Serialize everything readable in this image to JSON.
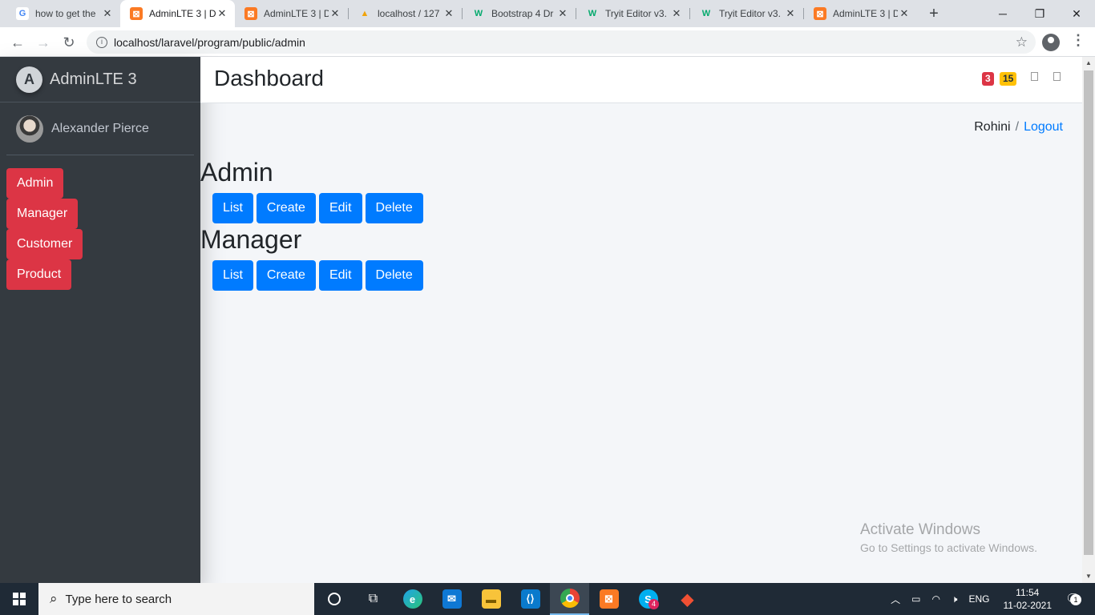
{
  "browser": {
    "tabs": [
      {
        "title": "how to get the",
        "favicon": "google-icon"
      },
      {
        "title": "AdminLTE 3 | D",
        "favicon": "xampp-icon",
        "active": true
      },
      {
        "title": "AdminLTE 3 | D",
        "favicon": "xampp-icon"
      },
      {
        "title": "localhost / 127",
        "favicon": "phpmyadmin-icon"
      },
      {
        "title": "Bootstrap 4 Dr",
        "favicon": "w3schools-icon"
      },
      {
        "title": "Tryit Editor v3.",
        "favicon": "w3schools-icon"
      },
      {
        "title": "Tryit Editor v3.",
        "favicon": "w3schools-icon"
      },
      {
        "title": "AdminLTE 3 | D",
        "favicon": "xampp-icon"
      }
    ],
    "url": "localhost/laravel/program/public/admin"
  },
  "sidebar": {
    "brand": "AdminLTE 3",
    "user": "Alexander Pierce",
    "items": [
      {
        "label": "Admin"
      },
      {
        "label": "Manager"
      },
      {
        "label": "Customer"
      },
      {
        "label": "Product"
      }
    ]
  },
  "header": {
    "title": "Dashboard",
    "badge_danger": "3",
    "badge_warning": "15"
  },
  "breadcrumb": {
    "user": "Rohini",
    "logout": "Logout"
  },
  "sections": [
    {
      "title": "Admin",
      "buttons": [
        "List",
        "Create",
        "Edit",
        "Delete"
      ]
    },
    {
      "title": "Manager",
      "buttons": [
        "List",
        "Create",
        "Edit",
        "Delete"
      ]
    }
  ],
  "watermark": {
    "line1": "Activate Windows",
    "line2": "Go to Settings to activate Windows."
  },
  "taskbar": {
    "search_placeholder": "Type here to search",
    "skype_badge": "4",
    "language": "ENG",
    "time": "11:54",
    "date": "11-02-2021",
    "notification_count": "1"
  },
  "colors": {
    "sidebar_bg": "#343a40",
    "danger": "#dc3545",
    "primary": "#007bff",
    "warning": "#ffc107"
  }
}
